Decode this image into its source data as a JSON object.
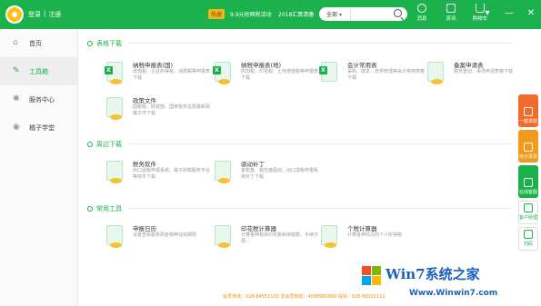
{
  "topbar": {
    "login": "登录",
    "divider": "|",
    "register": "注册",
    "hot_badge": "热搜",
    "promo_1": "9.9元抢网税活动",
    "promo_2": "2018汇算清缴",
    "search": {
      "category": "全部",
      "placeholder": ""
    },
    "actions": [
      {
        "label": "消息",
        "icon": "message-icon"
      },
      {
        "label": "资讯",
        "icon": "news-icon"
      },
      {
        "label": "购物车",
        "icon": "cart-icon"
      }
    ]
  },
  "sidebar": {
    "items": [
      {
        "label": "首页",
        "icon": "home-icon",
        "active": false
      },
      {
        "label": "工具箱",
        "icon": "wrench-icon",
        "active": true
      },
      {
        "label": "服务中心",
        "icon": "service-icon",
        "active": false
      },
      {
        "label": "橘子学堂",
        "icon": "school-icon",
        "active": false
      }
    ]
  },
  "sections": {
    "forms": {
      "title": "表格下载",
      "cards": [
        {
          "title": "纳税申报表(国)",
          "desc": "增值税、企业所得税、消费税等申报表下载"
        },
        {
          "title": "纳税申报表(地)",
          "desc": "附加税、印花税、土地增值税等申报表下载"
        },
        {
          "title": "会计常用表",
          "desc": "采购、成本、日常管理等会计常用表格下载"
        },
        {
          "title": "备案申请表",
          "desc": "税务登记、事项申请表格下载"
        },
        {
          "title": "政策文件",
          "desc": "国税税、财政部、国家税务总局最新政策文件下载"
        }
      ]
    },
    "tools": {
      "title": "周边下载",
      "cards": [
        {
          "title": "税务软件",
          "desc": "出口退税申报系统、橘子财税服务平台等软件下载"
        },
        {
          "title": "驱动补丁",
          "desc": "金税盘、税控盘驱动、出口退税申报系统补丁下载"
        }
      ]
    },
    "common": {
      "title": "常用工具",
      "cards": [
        {
          "title": "申报日历",
          "desc": "设置查看税务局各税种征收期限"
        },
        {
          "title": "印花税计算器",
          "desc": "计算各种税目印花税和纳税额，手续方便..."
        },
        {
          "title": "个税计算器",
          "desc": "计算各种情况的个人所得税"
        }
      ]
    }
  },
  "float_panel": [
    {
      "label": "一键求助",
      "color": "#f26b2c"
    },
    {
      "label": "电子发票",
      "color": "#f29a1c"
    },
    {
      "label": "在线客服",
      "color": "#1bb14c"
    },
    {
      "label": "客户经理",
      "color": "#ffffff"
    },
    {
      "label": "扫码",
      "color": "#ffffff"
    }
  ],
  "footer": "会员专线：028-84551133  非会员热线：4008990000 投诉：028-69311111",
  "watermark": {
    "brand": "Win7系统之家",
    "url": "Www.Winwin7.com"
  },
  "colors": {
    "brand_green": "#1bb14c",
    "accent_orange": "#f08a00"
  }
}
